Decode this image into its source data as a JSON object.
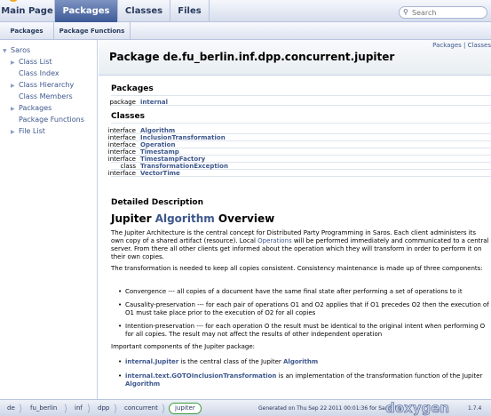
{
  "main_tabs": [
    "Main Page",
    "Packages",
    "Classes",
    "Files"
  ],
  "search": {
    "placeholder": "Search"
  },
  "sub_tabs": [
    "Packages",
    "Package Functions"
  ],
  "sidebar": {
    "items": [
      {
        "label": "Saros",
        "arrow": "▼"
      },
      {
        "label": "Class List",
        "arrow": "▶"
      },
      {
        "label": "Class Index",
        "arrow": ""
      },
      {
        "label": "Class Hierarchy",
        "arrow": "▶"
      },
      {
        "label": "Class Members",
        "arrow": ""
      },
      {
        "label": "Packages",
        "arrow": "▶"
      },
      {
        "label": "Package Functions",
        "arrow": ""
      },
      {
        "label": "File List",
        "arrow": "▶"
      }
    ]
  },
  "header": {
    "summary_links": "Packages | Classes",
    "title": "Package de.fu_berlin.inf.dpp.concurrent.jupiter"
  },
  "packages_section": {
    "heading": "Packages",
    "rows": [
      {
        "kind": "package",
        "name": "internal"
      }
    ]
  },
  "classes_section": {
    "heading": "Classes",
    "rows": [
      {
        "kind": "interface",
        "name": "Algorithm"
      },
      {
        "kind": "interface",
        "name": "InclusionTransformation"
      },
      {
        "kind": "interface",
        "name": "Operation"
      },
      {
        "kind": "interface",
        "name": "Timestamp"
      },
      {
        "kind": "interface",
        "name": "TimestampFactory"
      },
      {
        "kind": "class",
        "name": "TransformationException"
      },
      {
        "kind": "interface",
        "name": "VectorTime"
      }
    ]
  },
  "detail": {
    "heading": "Detailed Description",
    "overview_prefix": "Jupiter ",
    "overview_link": "Algorithm",
    "overview_suffix": " Overview",
    "p1_a": "The Jupiter Architecture is the central concept for Distributed Party Programming in Saros. Each client administers its own copy of a shared artifact (resource). Local ",
    "p1_link": "Operations",
    "p1_b": " will be performed immediately and communicated to a central server. From there all other clients get informed about the operation which they will transform in order to perform it on their own copies.",
    "p2": "The transformation is needed to keep all copies consistent. Consistency maintenance is made up of three components:",
    "bullets": [
      "Convergence --- all copies of a document have the same final state after performing a set of operations to it",
      "Causality-preservation --- for each pair of operations O1 and O2 applies that if O1 precedes O2 then the execution of O1 must take place prior to the execution of O2 for all copies",
      "Intention-preservation --- for each operation O the result must be identical to the original intent when performing O for all copies. The result may not affect the results of other independent operation"
    ],
    "p3": "Important components of the Jupiter package:",
    "comp1_link": "internal.Jupiter",
    "comp1_text": " is the central class of the Jupiter ",
    "comp1_link2": "Algorithm",
    "comp2_link": "internal.text.GOTOInclusionTransformation",
    "comp2_text": " is an implementation of the transformation function of the Jupiter ",
    "comp2_link2": "Algorithm"
  },
  "footer": {
    "breadcrumbs": [
      "de",
      "fu_berlin",
      "inf",
      "dpp",
      "concurrent",
      "jupiter"
    ],
    "generated": "Generated on Thu Sep 22 2011 00:01:36 for Saros by",
    "logo": "doxygen",
    "version": "1.7.4"
  },
  "colors": {
    "link": "#3d578c",
    "active_tab": "#3d5a97",
    "current_crumb_border": "#3a9b3a"
  }
}
